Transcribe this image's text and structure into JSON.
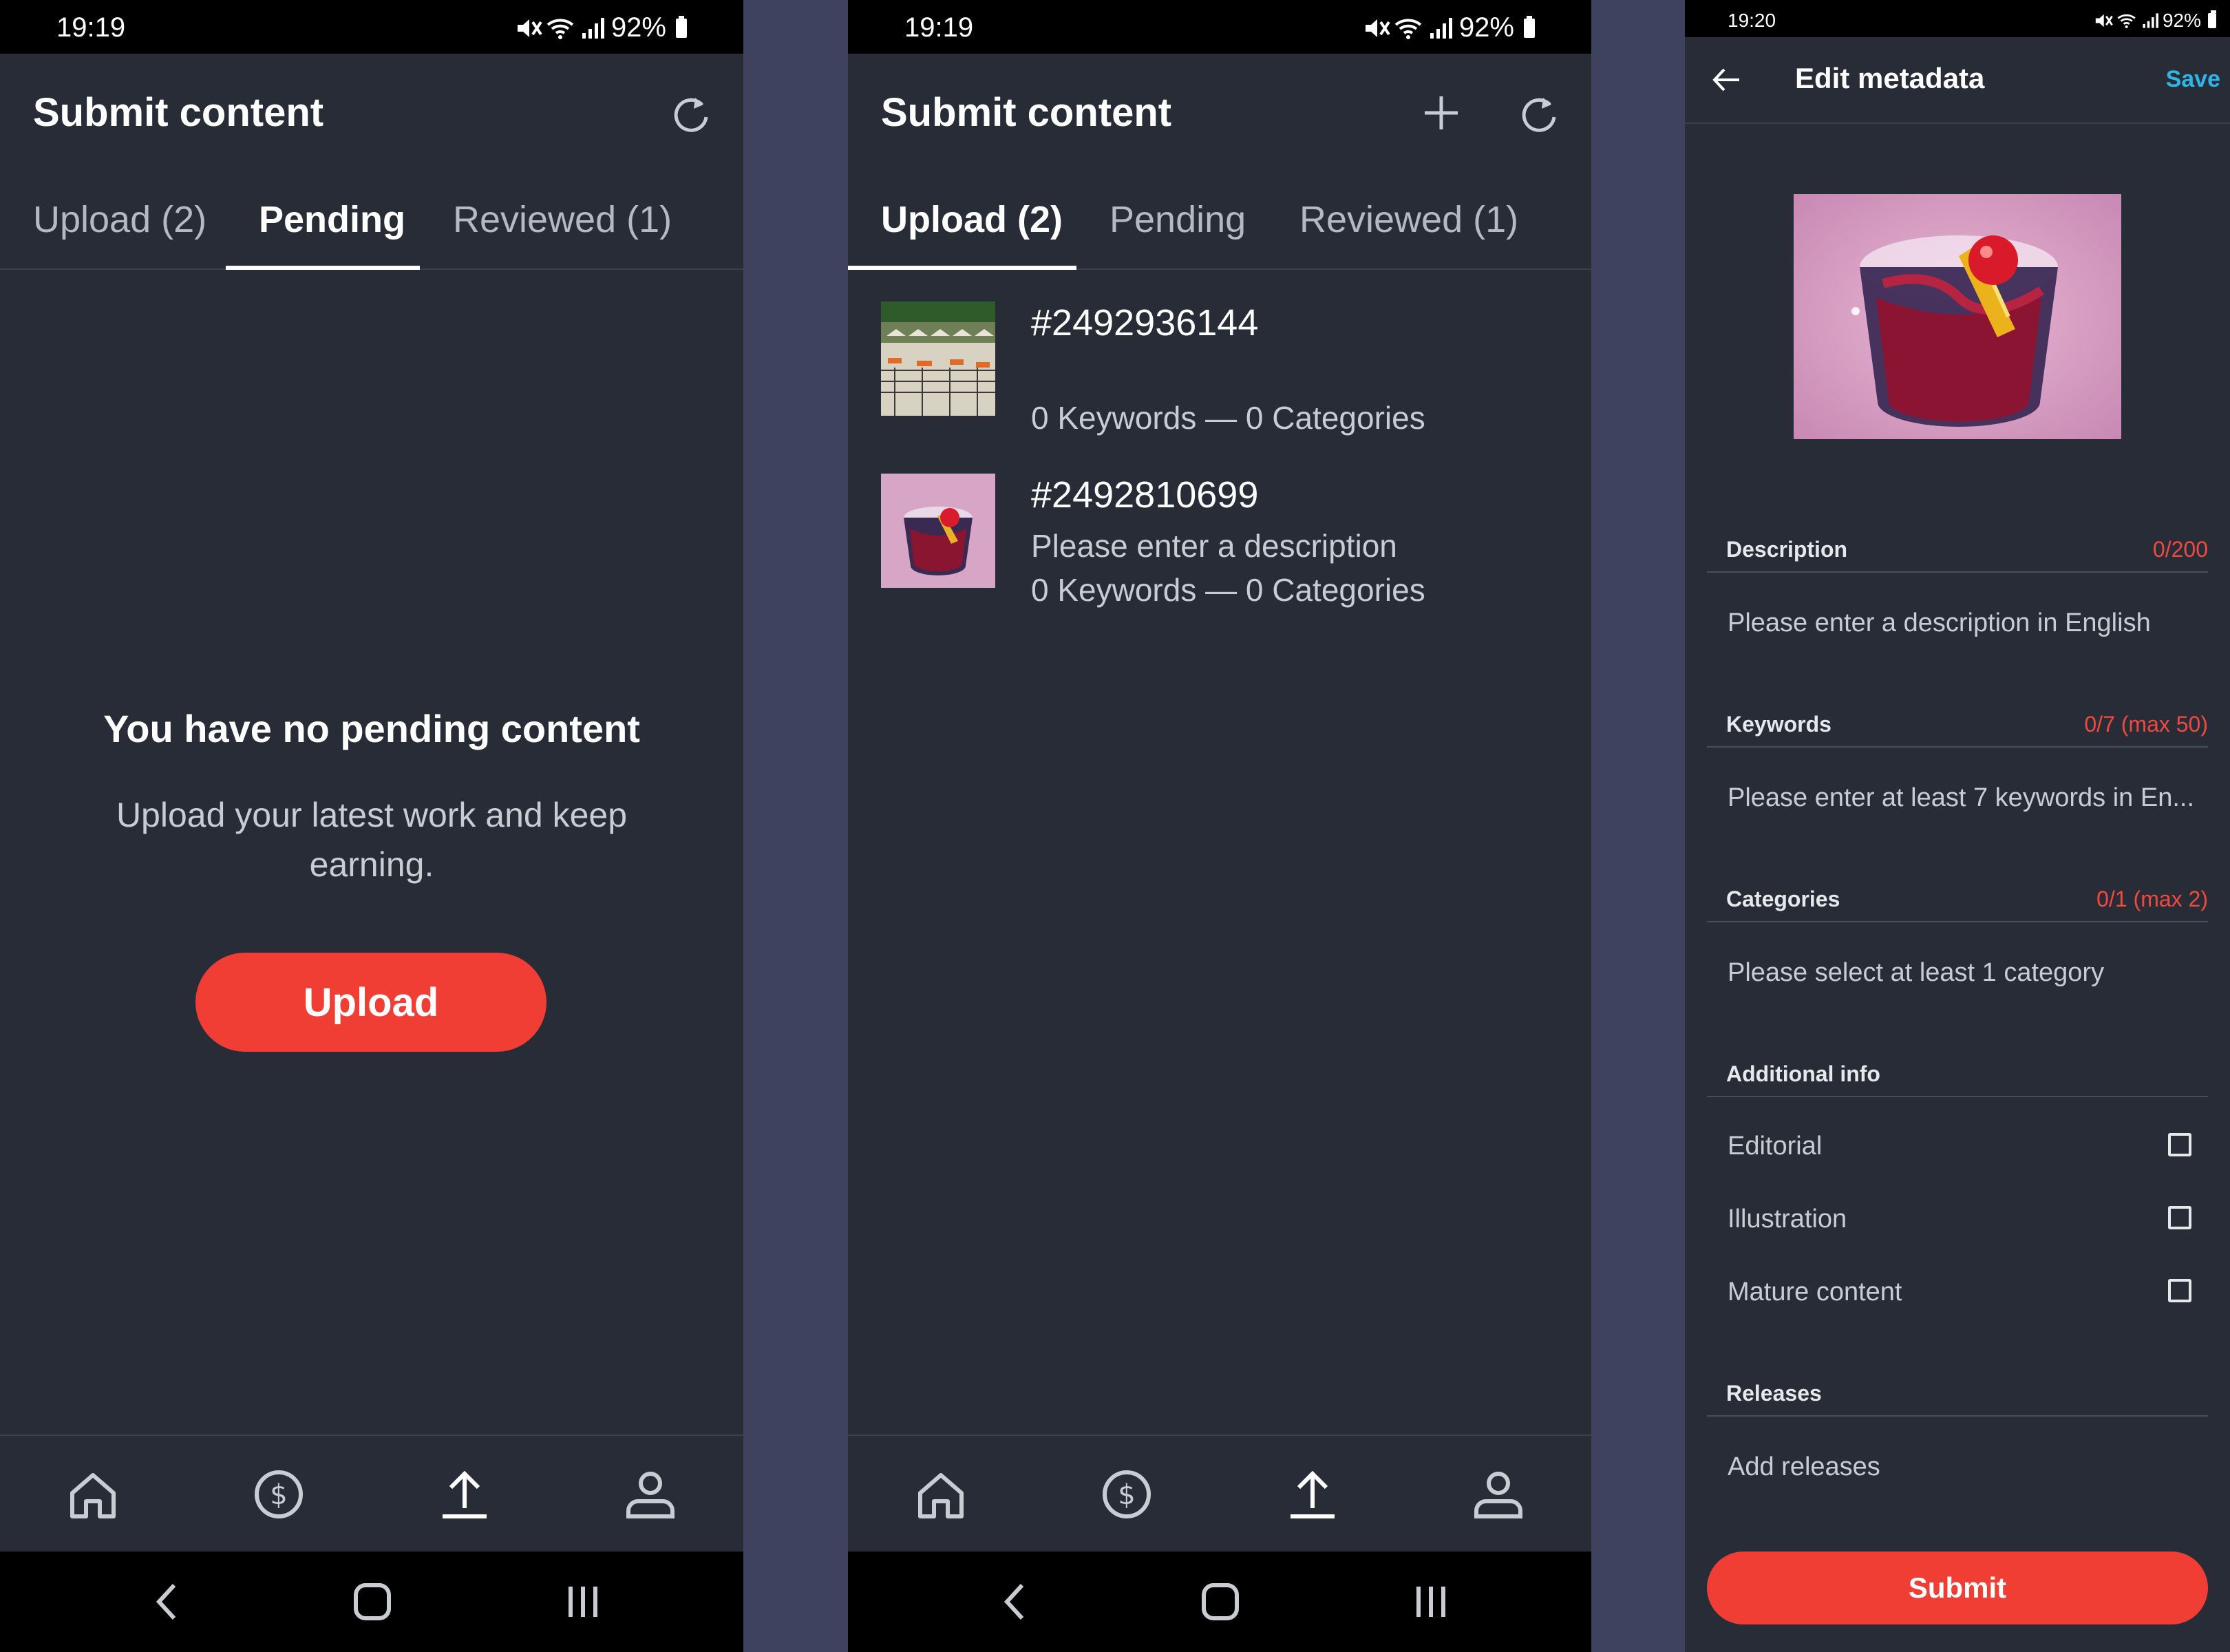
{
  "colors": {
    "background": "#282c37",
    "accent": "#f03e35",
    "link": "#2fb4e6",
    "error": "#f04a40"
  },
  "screen1": {
    "status": {
      "time": "19:19",
      "battery": "92%"
    },
    "title": "Submit content",
    "tabs": [
      "Upload (2)",
      "Pending",
      "Reviewed (1)"
    ],
    "active_tab": "Pending",
    "empty_title": "You have no pending content",
    "empty_subtitle": "Upload your latest work and keep earning.",
    "upload_label": "Upload",
    "nav": [
      "home-icon",
      "dollar-icon",
      "upload-icon",
      "profile-icon"
    ]
  },
  "screen2": {
    "status": {
      "time": "19:19",
      "battery": "92%"
    },
    "title": "Submit content",
    "tabs": [
      "Upload (2)",
      "Pending",
      "Reviewed (1)"
    ],
    "active_tab": "Upload (2)",
    "items": [
      {
        "id": "#2492936144",
        "description": "",
        "meta": "0 Keywords — 0 Categories"
      },
      {
        "id": "#2492810699",
        "description": "Please enter a description",
        "meta": "0 Keywords — 0 Categories"
      }
    ]
  },
  "screen3": {
    "status": {
      "time": "19:20",
      "battery": "92%"
    },
    "title": "Edit metadata",
    "save_label": "Save",
    "description": {
      "label": "Description",
      "count": "0/200",
      "placeholder": "Please enter a description in English"
    },
    "keywords": {
      "label": "Keywords",
      "count": "0/7 (max 50)",
      "placeholder": "Please enter at least 7 keywords in En..."
    },
    "categories": {
      "label": "Categories",
      "count": "0/1 (max 2)",
      "placeholder": "Please select at least 1 category"
    },
    "additional": {
      "label": "Additional info",
      "options": [
        "Editorial",
        "Illustration",
        "Mature content"
      ]
    },
    "releases": {
      "label": "Releases",
      "placeholder": "Add releases"
    },
    "submit_label": "Submit"
  }
}
